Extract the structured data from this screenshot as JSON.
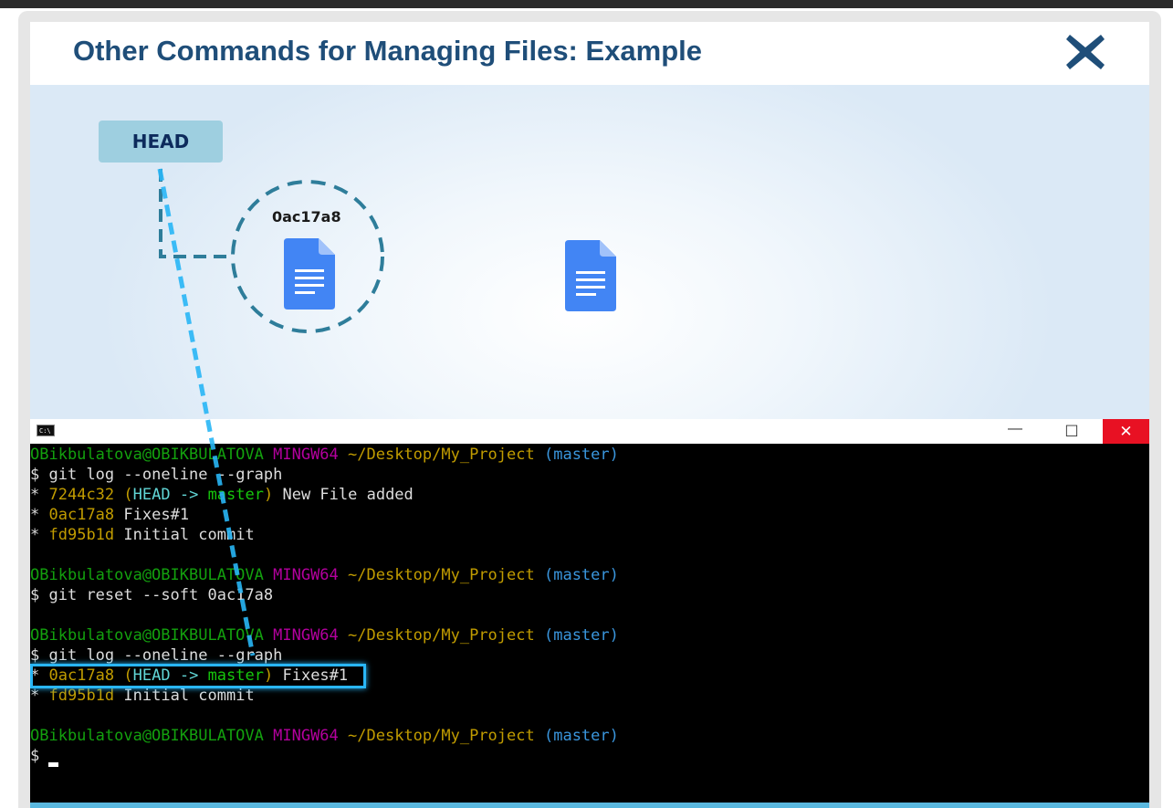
{
  "slide": {
    "title": "Other Commands for Managing Files: Example",
    "close_icon": "close-x-icon"
  },
  "diagram": {
    "head_label": "HEAD",
    "commit_label": "0ac17a8",
    "doc_icon": "document-icon"
  },
  "terminal": {
    "window_icon": "command-prompt-icon",
    "icon_text": "C:\\",
    "minimize_label": "—",
    "maximize_label": "☐",
    "close_label": "✕",
    "user_host": "OBikbulatova@OBIKBULATOVA",
    "shell": "MINGW64",
    "path": "~/Desktop/My_Project",
    "branch": "(master)",
    "prompt": "$",
    "cmd1": "git log --oneline --graph",
    "log1": [
      {
        "star": "*",
        "hash": "7244c32",
        "ref_open": "(",
        "head": "HEAD ->",
        "branch": "master",
        "ref_close": ")",
        "msg": "New File added"
      },
      {
        "star": "*",
        "hash": "0ac17a8",
        "msg": "Fixes#1"
      },
      {
        "star": "*",
        "hash": "fd95b1d",
        "msg": "Initial commit"
      }
    ],
    "cmd2": "git reset --soft 0ac17a8",
    "cmd3": "git log --oneline --graph",
    "log2": [
      {
        "star": "*",
        "hash": "0ac17a8",
        "ref_open": "(",
        "head": "HEAD ->",
        "branch": "master",
        "ref_close": ")",
        "msg": "Fixes#1"
      },
      {
        "star": "*",
        "hash": "fd95b1d",
        "msg": "Initial commit"
      }
    ]
  },
  "colors": {
    "title": "#1f4e79",
    "head_box": "#9ecfe0",
    "circle": "#2e7d9a",
    "arrow": "#29b6f6",
    "doc": "#4285f4"
  }
}
